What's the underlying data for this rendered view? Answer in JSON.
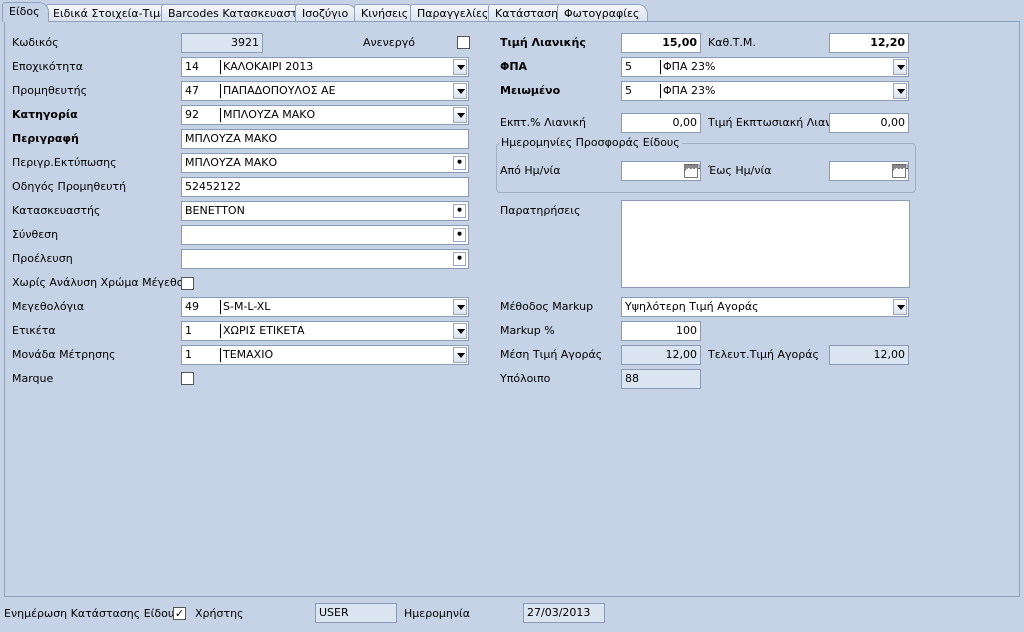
{
  "tabs": [
    "Είδος",
    "Ειδικά Στοιχεία-Τιμές",
    "Barcodes Κατασκευαστή",
    "Ισοζύγιο",
    "Κινήσεις",
    "Παραγγελίες",
    "Κατάσταση",
    "Φωτογραφίες"
  ],
  "left": {
    "code_label": "Κωδικός",
    "code_value": "3921",
    "inactive_label": "Ανενεργό",
    "season_label": "Εποχικότητα",
    "season_code": "14",
    "season_text": "ΚΑΛΟΚΑΙΡΙ 2013",
    "supplier_label": "Προμηθευτής",
    "supplier_code": "47",
    "supplier_text": "ΠΑΠΑΔΟΠΟΥΛΟΣ ΑΕ",
    "category_label": "Κατηγορία",
    "category_code": "92",
    "category_text": "ΜΠΛΟΥΖΑ ΜΑΚΟ",
    "description_label": "Περιγραφή",
    "description_value": "ΜΠΛΟΥΖΑ ΜΑΚΟ",
    "print_desc_label": "Περιγρ.Εκτύπωσης",
    "print_desc_value": "ΜΠΛΟΥΖΑ ΜΑΚΟ",
    "supplier_guide_label": "Οδηγός Προμηθευτή",
    "supplier_guide_value": "52452122",
    "manufacturer_label": "Κατασκευαστής",
    "manufacturer_value": "BENETTON",
    "composition_label": "Σύνθεση",
    "composition_value": "",
    "origin_label": "Προέλευση",
    "origin_value": "",
    "no_analysis_label": "Χωρίς Ανάλυση Χρώμα Μέγεθος",
    "sizes_label": "Μεγεθολόγια",
    "sizes_code": "49",
    "sizes_text": "S-M-L-XL",
    "tag_label": "Ετικέτα",
    "tag_code": "1",
    "tag_text": "ΧΩΡΙΣ ΕΤΙΚΕΤΑ",
    "unit_label": "Μονάδα Μέτρησης",
    "unit_code": "1",
    "unit_text": "ΤΕΜΑΧΙΟ",
    "marque_label": "Marque"
  },
  "right": {
    "retail_label": "Τιμή Λιανικής",
    "retail_value": "15,00",
    "net_label": "Καθ.Τ.Μ.",
    "net_value": "12,20",
    "vat_label": "ΦΠΑ",
    "vat_code": "5",
    "vat_text": "ΦΠΑ 23%",
    "reduced_label": "Μειωμένο",
    "reduced_code": "5",
    "reduced_text": "ΦΠΑ 23%",
    "discount_pct_label": "Εκπτ.% Λιανική",
    "discount_pct_value": "0,00",
    "discount_price_label": "Τιμή Εκπτωσιακή Λιαν.",
    "discount_price_value": "0,00",
    "offer_group_title": "Ημερομηνίες Προσφοράς Είδους",
    "from_label": "Από Ημ/νία",
    "from_value": "",
    "to_label": "Έως Ημ/νία",
    "to_value": "",
    "notes_label": "Παρατηρήσεις",
    "notes_value": "",
    "markup_method_label": "Μέθοδος Markup",
    "markup_method_value": "Υψηλότερη Τιμή Αγοράς",
    "markup_pct_label": "Markup %",
    "markup_pct_value": "100",
    "avg_cost_label": "Μέση Τιμή Αγοράς",
    "avg_cost_value": "12,00",
    "last_cost_label": "Τελευτ.Τιμή Αγοράς",
    "last_cost_value": "12,00",
    "balance_label": "Υπόλοιπο",
    "balance_value": "88",
    "cal_icon_text": "JAN 1"
  },
  "footer": {
    "update_label": "Ενημέρωση Κατάστασης Είδους",
    "user_label": "Χρήστης",
    "user_value": "USER",
    "date_label": "Ημερομηνία",
    "date_value": "27/03/2013",
    "user_checked_mark": "✓"
  }
}
